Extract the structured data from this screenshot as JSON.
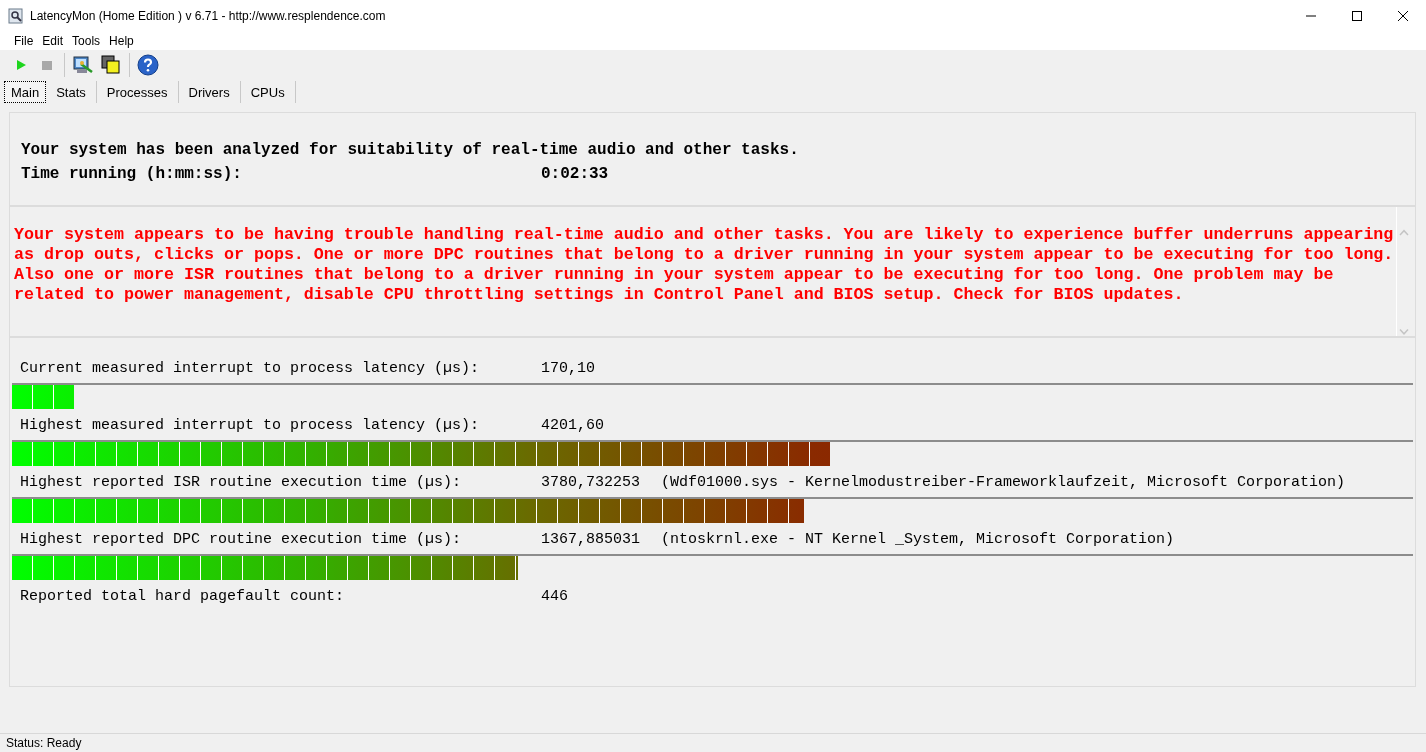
{
  "window": {
    "title": "LatencyMon  (Home Edition )  v 6.71 - http://www.resplendence.com"
  },
  "menu": [
    "File",
    "Edit",
    "Tools",
    "Help"
  ],
  "tabs": [
    {
      "label": "Main",
      "selected": true
    },
    {
      "label": "Stats",
      "selected": false
    },
    {
      "label": "Processes",
      "selected": false
    },
    {
      "label": "Drivers",
      "selected": false
    },
    {
      "label": "CPUs",
      "selected": false
    }
  ],
  "summary": {
    "headline": "Your system has been analyzed for suitability of real-time audio and other tasks.",
    "time_label": "Time running (h:mm:ss):",
    "time_value": "0:02:33"
  },
  "verdict": "Your system appears to be having trouble handling real-time audio and other tasks. You are likely to experience buffer underruns appearing as drop outs, clicks or pops. One or more DPC routines that belong to a driver running in your system appear to be executing for too long. Also one or more ISR routines that belong to a driver running in your system appear to be executing for too long. One problem may be related to power management, disable CPU throttling settings in Control Panel and BIOS setup. Check for BIOS updates.",
  "metrics": [
    {
      "label": "Current measured interrupt to process latency (µs):",
      "value": "170,10",
      "level": 0.044
    },
    {
      "label": "Highest measured interrupt to process latency (µs):",
      "value": "4201,60",
      "level": 0.584
    },
    {
      "label": "Highest reported ISR routine execution time (µs):",
      "value": "3780,732253",
      "detail": "(Wdf01000.sys - Kernelmodustreiber-Frameworklaufzeit, Microsoft Corporation)",
      "level": 0.565
    },
    {
      "label": "Highest reported DPC routine execution time (µs):",
      "value": "1367,885031",
      "detail": "(ntoskrnl.exe - NT Kernel _System, Microsoft Corporation)",
      "level": 0.361
    },
    {
      "label": "Reported total hard pagefault count:",
      "value": "446"
    }
  ],
  "status_bar": "Status: Ready"
}
